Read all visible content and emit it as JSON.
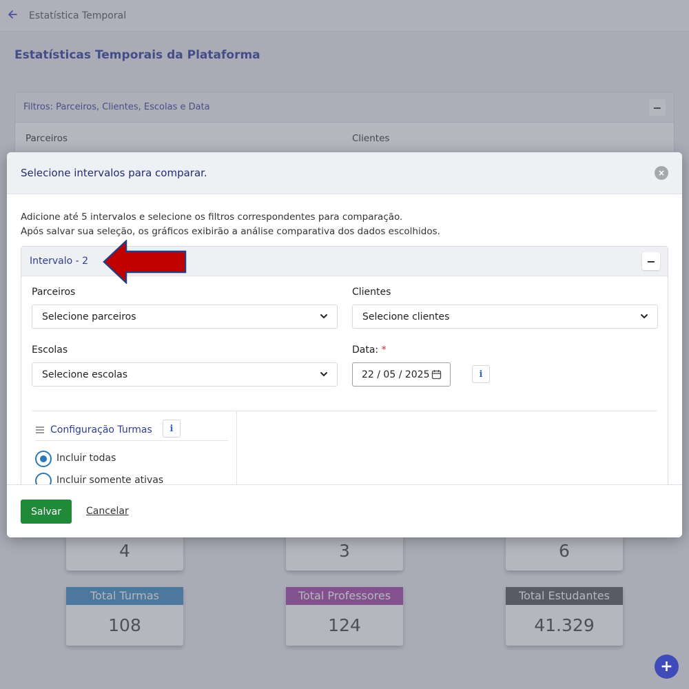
{
  "topbar": {
    "title": "Estatística Temporal"
  },
  "page": {
    "title": "Estatísticas Temporais da Plataforma"
  },
  "filters": {
    "header": "Filtros: Parceiros, Clientes, Escolas e Data",
    "collapse": "−",
    "label_parceiros": "Parceiros",
    "label_clientes": "Clientes"
  },
  "stats_top": [
    {
      "value": "4"
    },
    {
      "value": "3"
    },
    {
      "value": "6"
    }
  ],
  "stats": [
    {
      "label": "Total Turmas",
      "value": "108",
      "color": "#3e8ec1"
    },
    {
      "label": "Total Professores",
      "value": "124",
      "color": "#a548a7"
    },
    {
      "label": "Total Estudantes",
      "value": "41.329",
      "color": "#565860"
    }
  ],
  "fab": {
    "label": "+"
  },
  "modal": {
    "title": "Selecione intervalos para comparar.",
    "close": "×",
    "desc_line1": "Adicione até 5 intervalos e selecione os filtros correspondentes para comparação.",
    "desc_line2": "Após salvar sua seleção, os gráficos exibirão a análise comparativa dos dados escolhidos.",
    "interval": {
      "title": "Intervalo - 2",
      "collapse": "−",
      "parceiros_label": "Parceiros",
      "parceiros_value": "Selecione parceiros",
      "clientes_label": "Clientes",
      "clientes_value": "Selecione clientes",
      "escolas_label": "Escolas",
      "escolas_value": "Selecione escolas",
      "data_label": "Data:",
      "data_required": "*",
      "data_value": "22 / 05 / 2025",
      "info": "i",
      "turmas_label": "Configuração Turmas",
      "radio_all": "Incluir todas",
      "radio_active": "Incluir somente ativas"
    },
    "save": "Salvar",
    "cancel": "Cancelar"
  },
  "colors": {
    "primary": "#3f4bb8",
    "save": "#1f8a37",
    "arrow": "#c10000"
  }
}
